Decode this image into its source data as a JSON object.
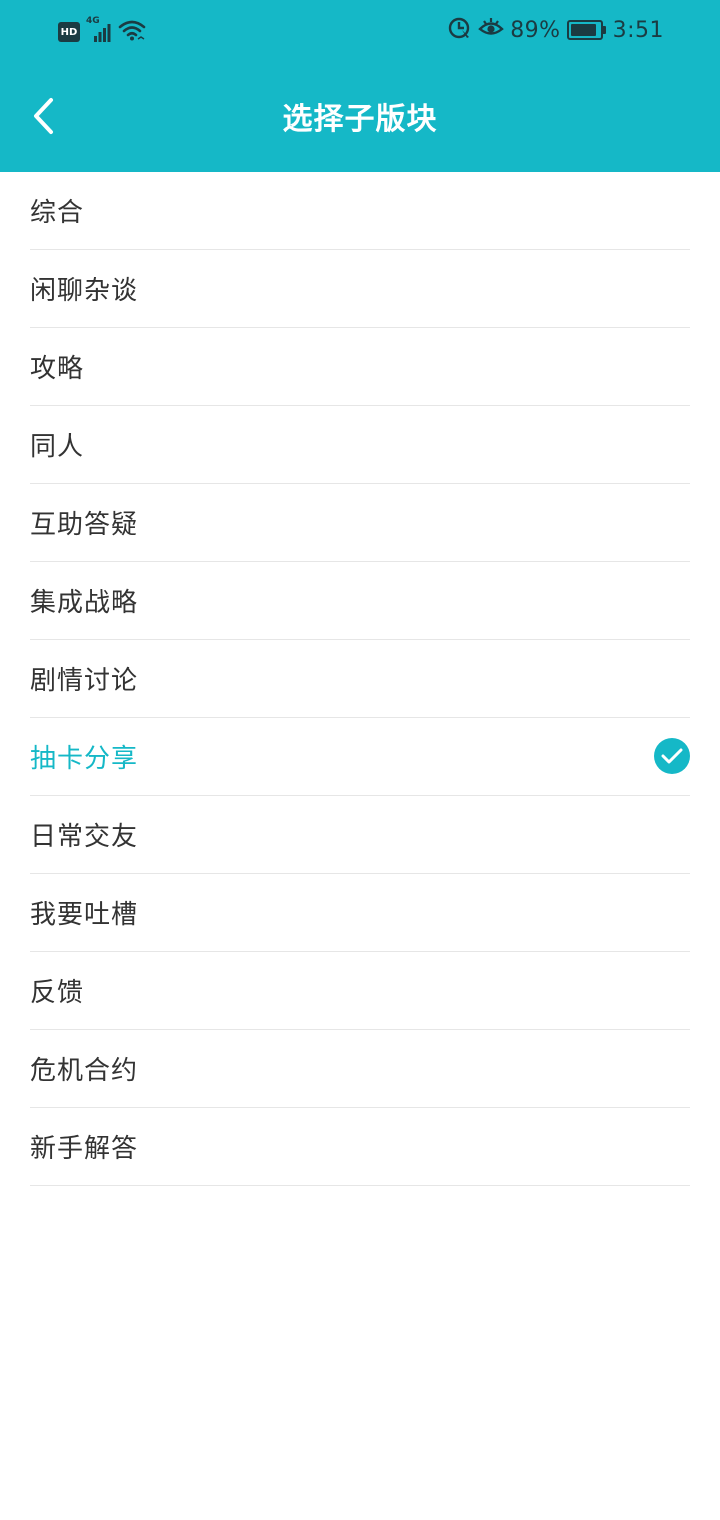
{
  "status_bar": {
    "network_type": "4G",
    "hd_label": "HD",
    "battery_percent": "89%",
    "battery_level": 0.89,
    "time": "3:51"
  },
  "header": {
    "title": "选择子版块",
    "back_icon": "chevron-left-icon"
  },
  "colors": {
    "accent": "#15b8c7",
    "text": "#333333",
    "divider": "#e6e6e6"
  },
  "list": {
    "items": [
      {
        "label": "综合",
        "selected": false
      },
      {
        "label": "闲聊杂谈",
        "selected": false
      },
      {
        "label": "攻略",
        "selected": false
      },
      {
        "label": "同人",
        "selected": false
      },
      {
        "label": "互助答疑",
        "selected": false
      },
      {
        "label": "集成战略",
        "selected": false
      },
      {
        "label": "剧情讨论",
        "selected": false
      },
      {
        "label": "抽卡分享",
        "selected": true
      },
      {
        "label": "日常交友",
        "selected": false
      },
      {
        "label": "我要吐槽",
        "selected": false
      },
      {
        "label": "反馈",
        "selected": false
      },
      {
        "label": "危机合约",
        "selected": false
      },
      {
        "label": "新手解答",
        "selected": false
      }
    ],
    "selected_icon": "check-circle-icon"
  }
}
